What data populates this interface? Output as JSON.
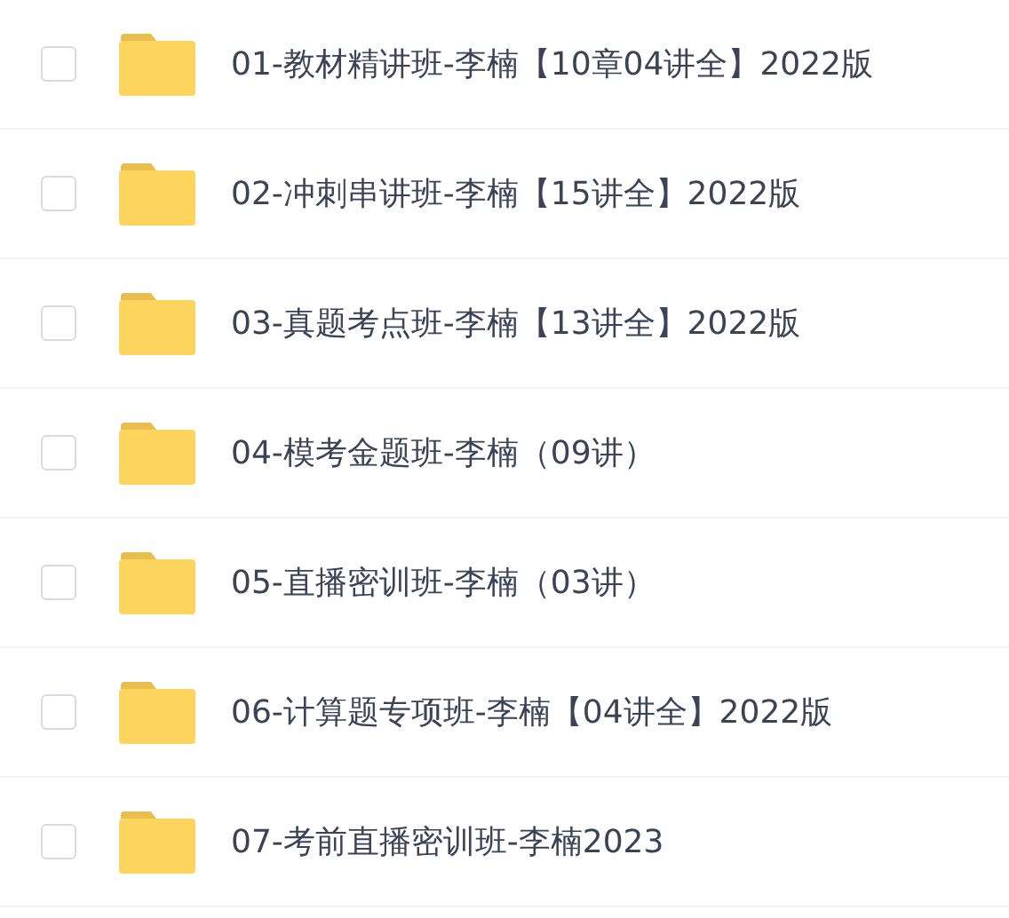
{
  "files": [
    {
      "name": "01-教材精讲班-李楠【10章04讲全】2022版",
      "checked": false
    },
    {
      "name": "02-冲刺串讲班-李楠【15讲全】2022版",
      "checked": false
    },
    {
      "name": "03-真题考点班-李楠【13讲全】2022版",
      "checked": false
    },
    {
      "name": "04-模考金题班-李楠（09讲）",
      "checked": false
    },
    {
      "name": "05-直播密训班-李楠（03讲）",
      "checked": false
    },
    {
      "name": "06-计算题专项班-李楠【04讲全】2022版",
      "checked": false
    },
    {
      "name": "07-考前直播密训班-李楠2023",
      "checked": false
    }
  ]
}
